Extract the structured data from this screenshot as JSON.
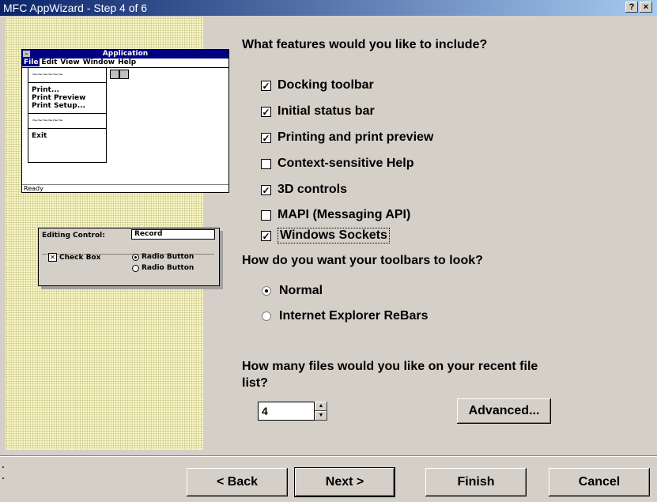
{
  "window": {
    "title": "MFC AppWizard - Step 4 of 6",
    "help_btn": "?",
    "close_btn": "×"
  },
  "preview": {
    "app_title": "Application",
    "menu": [
      "File",
      "Edit",
      "View",
      "Window",
      "Help"
    ],
    "dropdown_items": [
      "~~~~~~",
      "Print...",
      "Print Preview",
      "Print Setup...",
      "~~~~~~",
      "Exit"
    ],
    "status": "Ready",
    "control_panel": {
      "editing_label": "Editing Control:",
      "editing_value": "Record",
      "checkbox_label": "Check Box",
      "radio1_label": "Radio Button",
      "radio2_label": "Radio Button"
    }
  },
  "features": {
    "heading": "What features would you like to include?",
    "items": [
      {
        "label": "Docking toolbar",
        "checked": true
      },
      {
        "label": "Initial status bar",
        "checked": true
      },
      {
        "label": "Printing and print preview",
        "checked": true
      },
      {
        "label": "Context-sensitive Help",
        "checked": false
      },
      {
        "label": "3D controls",
        "checked": true
      },
      {
        "label": "MAPI (Messaging API)",
        "checked": false
      },
      {
        "label": "Windows Sockets",
        "checked": true
      }
    ]
  },
  "toolbars": {
    "heading": "How do you want your toolbars to look?",
    "options": [
      {
        "label": "Normal",
        "selected": true
      },
      {
        "label": "Internet Explorer ReBars",
        "selected": false
      }
    ]
  },
  "recent_files": {
    "heading_line1": "How many files would you like on your recent file",
    "heading_line2": "list?",
    "value": "4",
    "advanced_label": "Advanced..."
  },
  "buttons": {
    "back": "< Back",
    "next": "Next >",
    "finish": "Finish",
    "cancel": "Cancel"
  }
}
